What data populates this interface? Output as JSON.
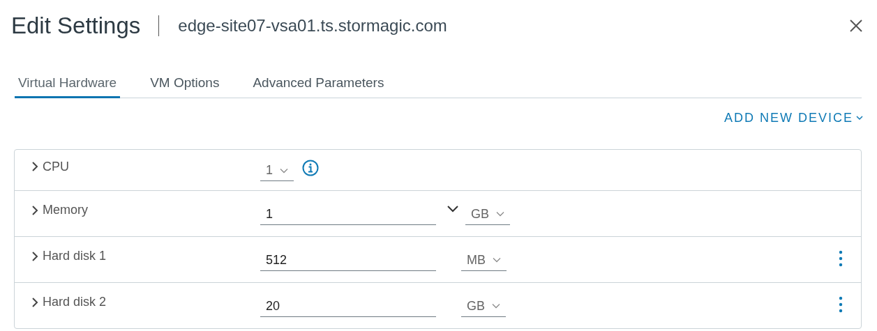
{
  "dialog": {
    "title": "Edit Settings",
    "subtitle": "edge-site07-vsa01.ts.stormagic.com"
  },
  "tabs": [
    {
      "label": "Virtual Hardware",
      "selected": true
    },
    {
      "label": "VM Options",
      "selected": false
    },
    {
      "label": "Advanced Parameters",
      "selected": false
    }
  ],
  "add_button": "ADD NEW DEVICE",
  "devices": [
    {
      "kind": "cpu",
      "name": "CPU",
      "value": "1"
    },
    {
      "kind": "memory",
      "name": "Memory",
      "value": "1",
      "unit": "GB"
    },
    {
      "kind": "disk",
      "name": "Hard disk 1",
      "value": "512",
      "unit": "MB"
    },
    {
      "kind": "disk",
      "name": "Hard disk 2",
      "value": "20",
      "unit": "GB"
    }
  ]
}
